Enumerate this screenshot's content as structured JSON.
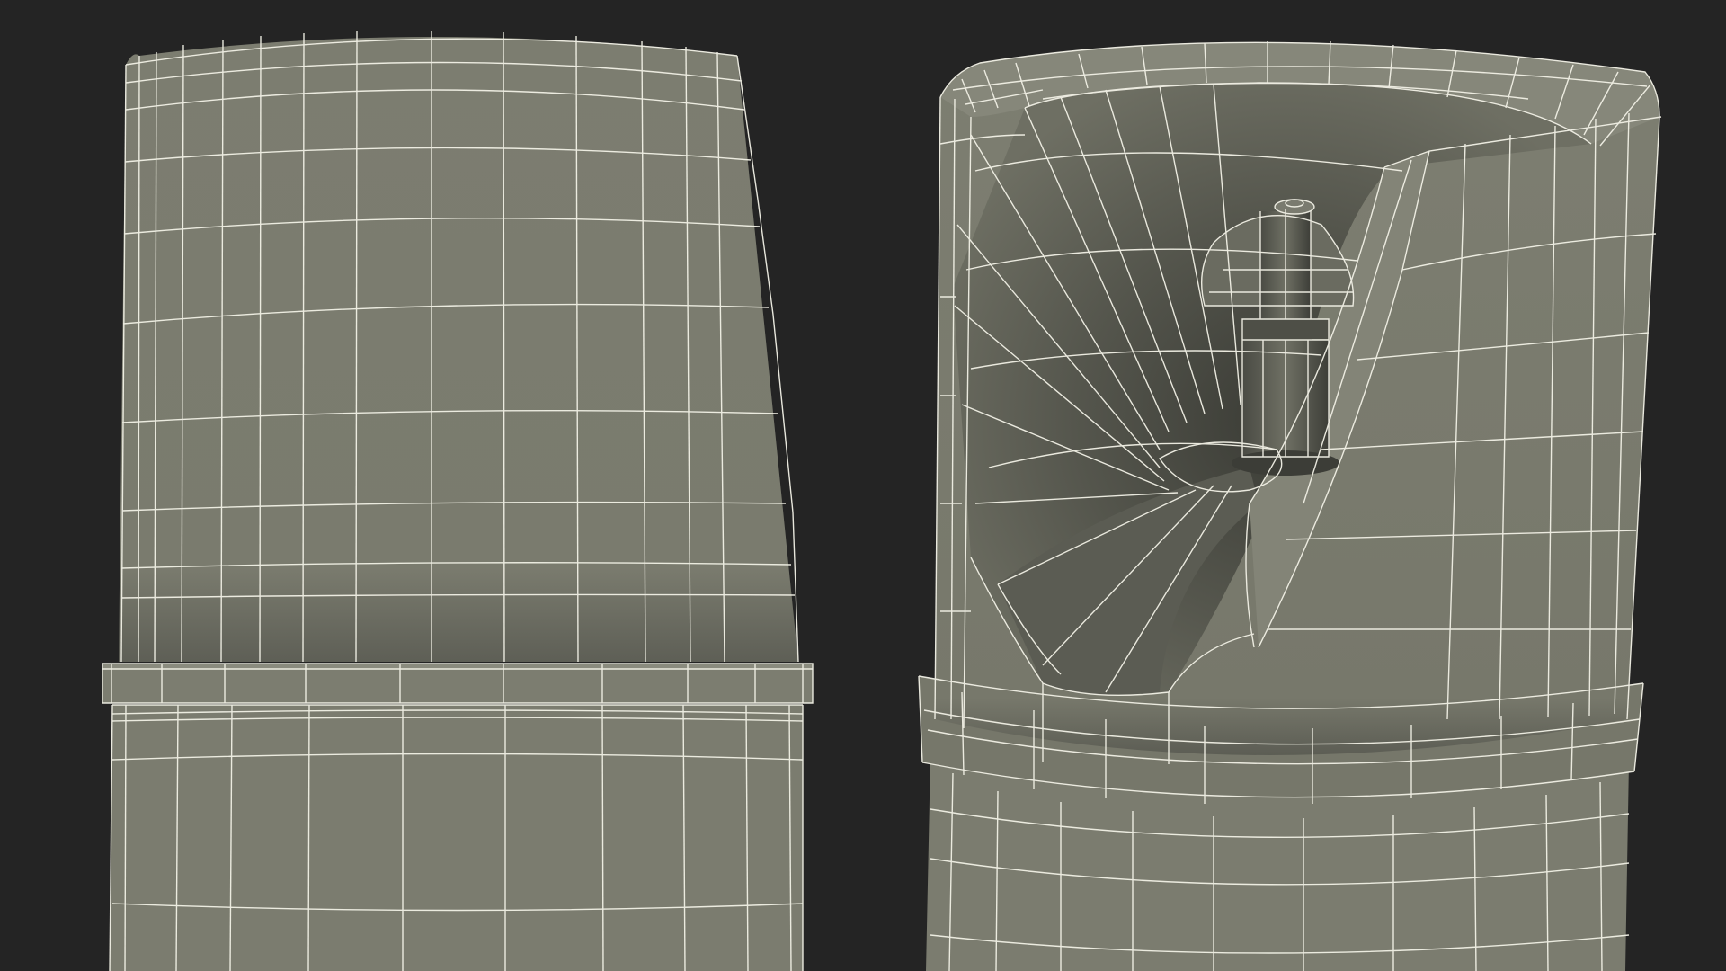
{
  "scene": {
    "background_color": "#242424",
    "surface_color": "#7c7d70",
    "surface_shadow_color": "#5a5b52",
    "surface_dark_color": "#3e3f39",
    "wire_color": "#f2f1e6",
    "objects": [
      "left-cylinder-cap-wireframe",
      "right-spray-cap-wireframe"
    ]
  }
}
